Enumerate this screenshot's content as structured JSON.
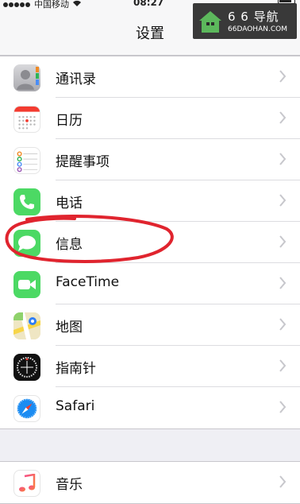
{
  "statusbar": {
    "carrier": "中国移动",
    "time": "08:27"
  },
  "navbar": {
    "title": "设置"
  },
  "watermark": {
    "title": "6 6 导航",
    "url": "66DAOHAN.COM"
  },
  "settings": {
    "group1": [
      {
        "label": "通讯录",
        "icon": "contacts-icon"
      },
      {
        "label": "日历",
        "icon": "calendar-icon"
      },
      {
        "label": "提醒事项",
        "icon": "reminders-icon"
      },
      {
        "label": "电话",
        "icon": "phone-icon"
      },
      {
        "label": "信息",
        "icon": "messages-icon"
      },
      {
        "label": "FaceTime",
        "icon": "facetime-icon"
      },
      {
        "label": "地图",
        "icon": "maps-icon"
      },
      {
        "label": "指南针",
        "icon": "compass-icon"
      },
      {
        "label": "Safari",
        "icon": "safari-icon"
      }
    ],
    "group2": [
      {
        "label": "音乐",
        "icon": "music-icon"
      }
    ]
  },
  "colors": {
    "phone_green": "#4cd964",
    "annotation_red": "#e0242e",
    "chevron": "#c7c7cc"
  }
}
